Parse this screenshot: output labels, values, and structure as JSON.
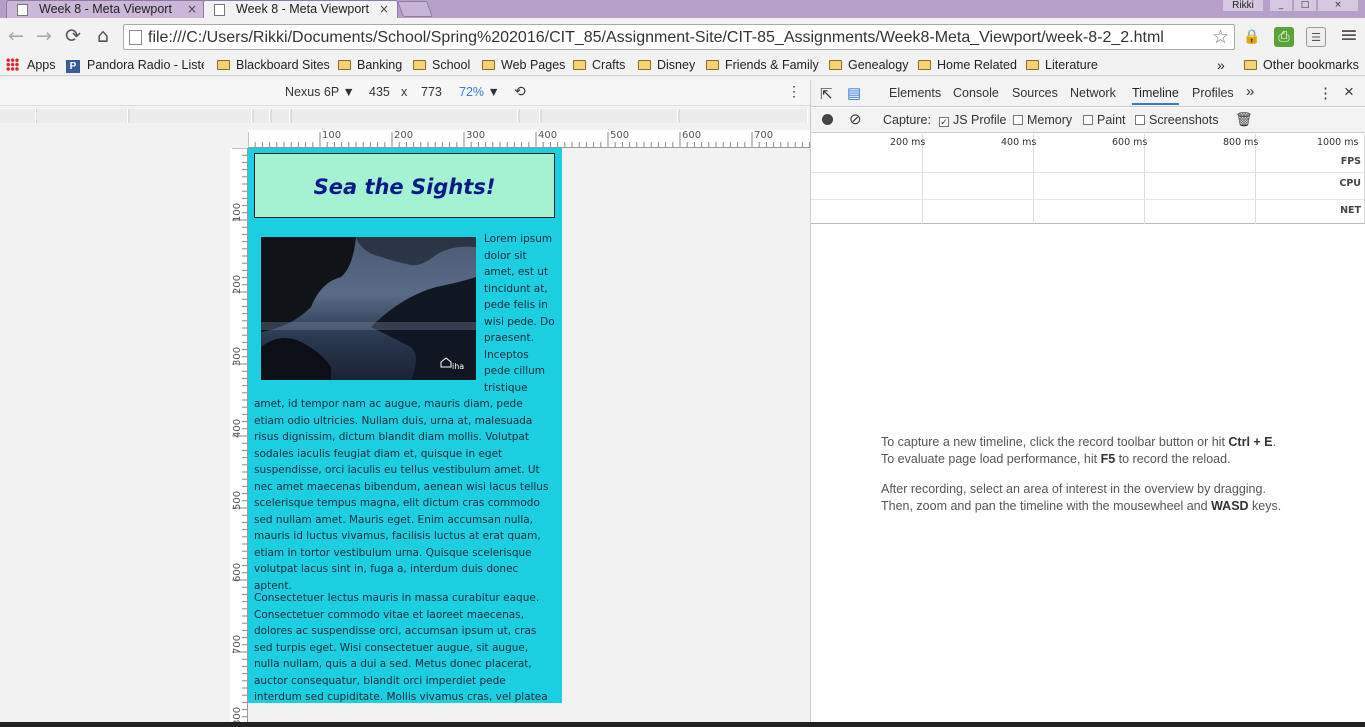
{
  "browser": {
    "tabs": [
      {
        "title": "Week 8 - Meta Viewport",
        "close": "×",
        "active": false
      },
      {
        "title": "Week 8 - Meta Viewport",
        "close": "×",
        "active": true
      }
    ],
    "user_name": "Rikki",
    "window_buttons": [
      "_",
      "□",
      "×"
    ],
    "url": "file:///C:/Users/Rikki/Documents/School/Spring%202016/CIT_85/Assignment-Site/CIT-85_Assignments/Week8-Meta_Viewport/week-8-2_2.html",
    "icons": {
      "back": "←",
      "forward": "→",
      "reload": "⟳",
      "home": "⌂",
      "star": "☆",
      "menu": "≡"
    }
  },
  "bookmarks": {
    "items": [
      "Apps",
      "Pandora Radio - Liste",
      "Blackboard Sites",
      "Banking",
      "School",
      "Web Pages",
      "Crafts",
      "Disney",
      "Friends & Family",
      "Genealogy",
      "Home Related",
      "Literature"
    ],
    "overflow": "»",
    "other": "Other bookmarks"
  },
  "device_toolbar": {
    "device": "Nexus 6P",
    "width": "435",
    "times": "x",
    "height": "773",
    "zoom": "72%",
    "rotate_icon": "⟲",
    "more_icon": "⋮"
  },
  "rulers": {
    "horizontal": [
      "100",
      "200",
      "300",
      "400",
      "500",
      "600",
      "700"
    ],
    "vertical": [
      "100",
      "200",
      "300",
      "400",
      "500",
      "600",
      "700",
      "800"
    ]
  },
  "site": {
    "title": "Sea the Sights!",
    "para1_side": "Lorem ipsum dolor sit amet, est ut tincidunt at, pede felis in wisi pede. Do praesent. Inceptos pede cillum tristique",
    "para1_full": "amet, id tempor nam ac augue, mauris diam, pede etiam odio ultricies. Nullam duis, urna at, malesuada risus dignissim, dictum blandit diam mollis. Volutpat sodales iaculis feugiat diam et, quisque in eget suspendisse, orci iaculis eu tellus vestibulum amet. Ut nec amet maecenas bibendum, aenean wisi lacus tellus scelerisque tempus magna, elit dictum cras commodo sed nullam amet. Mauris eget. Enim accumsan nulla, mauris id luctus vivamus, facilisis luctus at erat quam, etiam in tortor vestibulum urna. Quisque scelerisque volutpat lacus sint in, fuga a, interdum duis donec aptent.",
    "para2": "Consectetuer lectus mauris in massa curabitur eaque. Consectetuer commodo vitae et laoreet maecenas, dolores ac suspendisse orci, accumsan ipsum ut, cras sed turpis eget. Wisi consectetuer augue, sit augue, nulla nullam, quis a dui a sed. Metus donec placerat, auctor consequatur, blandit orci imperdiet pede interdum sed cupiditate. Mollis vivamus cras, vel platea",
    "watermark": "iha"
  },
  "devtools": {
    "tabs": [
      "Elements",
      "Console",
      "Sources",
      "Network",
      "Timeline",
      "Profiles"
    ],
    "active_tab": "Timeline",
    "overflow": "»",
    "more": "⋮",
    "close": "×",
    "capture_label": "Capture:",
    "checkboxes": [
      {
        "label": "JS Profile",
        "checked": true
      },
      {
        "label": "Memory",
        "checked": false
      },
      {
        "label": "Paint",
        "checked": false
      },
      {
        "label": "Screenshots",
        "checked": false
      }
    ],
    "time_marks": [
      "200 ms",
      "400 ms",
      "600 ms",
      "800 ms",
      "1000 ms"
    ],
    "lanes": [
      "FPS",
      "CPU",
      "NET"
    ],
    "hint1_pre": "To capture a new timeline, click the record toolbar button or hit ",
    "hint1_key": "Ctrl + E",
    "hint1_post": ".",
    "hint2_pre": "To evaluate page load performance, hit ",
    "hint2_key": "F5",
    "hint2_post": " to record the reload.",
    "hint3": "After recording, select an area of interest in the overview by dragging.",
    "hint4_pre": "Then, zoom and pan the timeline with the mousewheel and ",
    "hint4_key": "WASD",
    "hint4_post": " keys."
  }
}
